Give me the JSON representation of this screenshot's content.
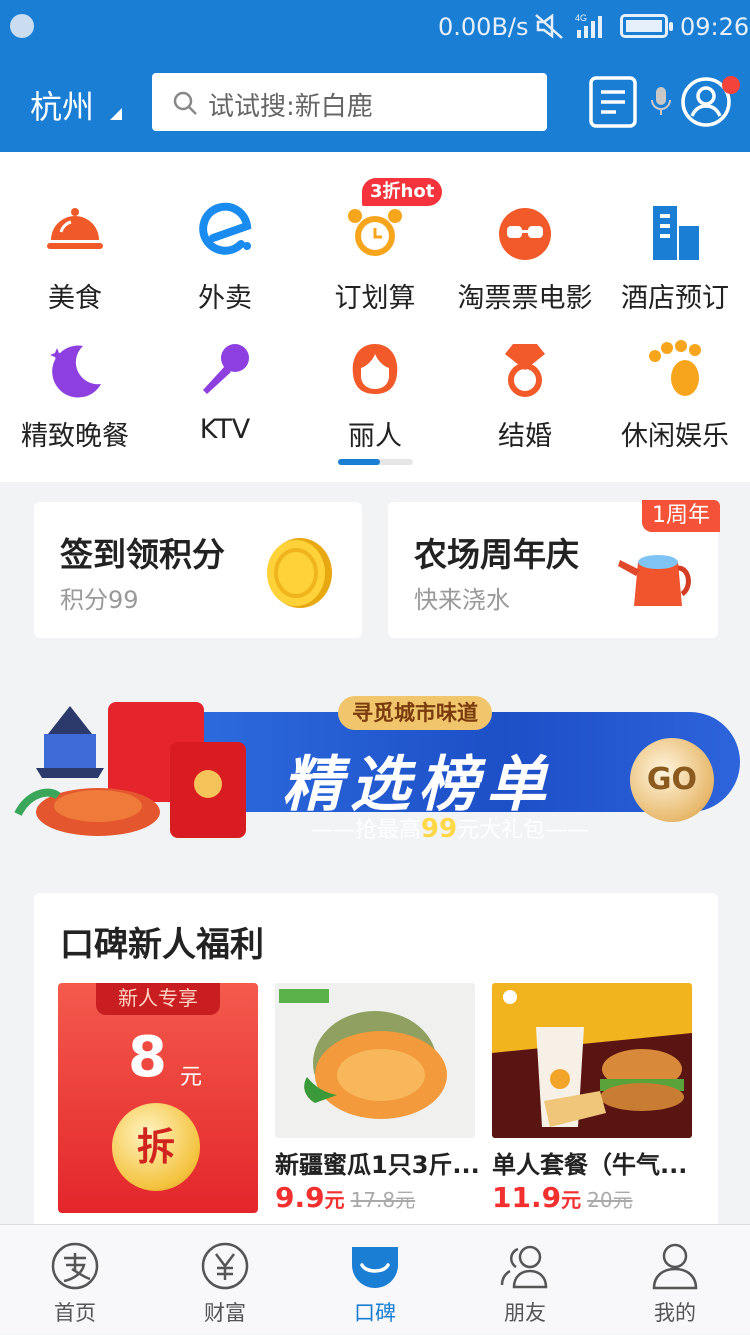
{
  "status_bar": {
    "speed": "0.00B/s",
    "network": "4G",
    "time": "09:26"
  },
  "header": {
    "city": "杭州",
    "search_placeholder": "试试搜:新白鹿"
  },
  "categories": [
    {
      "label": "美食",
      "icon": "food-cloche-icon"
    },
    {
      "label": "外卖",
      "icon": "ele-me-icon"
    },
    {
      "label": "订划算",
      "icon": "alarm-clock-icon",
      "badge": "3折hot"
    },
    {
      "label": "淘票票电影",
      "icon": "movie-glasses-icon"
    },
    {
      "label": "酒店预订",
      "icon": "hotel-building-icon"
    },
    {
      "label": "精致晚餐",
      "icon": "moon-star-icon"
    },
    {
      "label": "KTV",
      "icon": "microphone-icon"
    },
    {
      "label": "丽人",
      "icon": "beauty-face-icon"
    },
    {
      "label": "结婚",
      "icon": "wedding-ring-icon"
    },
    {
      "label": "休闲娱乐",
      "icon": "paw-icon"
    }
  ],
  "cards": {
    "checkin": {
      "title": "签到领积分",
      "subtitle": "积分99",
      "icon": "gold-coin-icon"
    },
    "farm": {
      "title": "农场周年庆",
      "subtitle": "快来浇水",
      "badge": "1周年",
      "icon": "watering-can-icon"
    }
  },
  "banner": {
    "tag": "寻觅城市味道",
    "title": "精选榜单",
    "sub_prefix": "——抢最高",
    "sub_amount": "99",
    "sub_suffix": "元大礼包——",
    "go": "GO"
  },
  "welfare": {
    "title": "口碑新人福利",
    "coupon": {
      "tag": "新人专享",
      "amount": "8",
      "unit": "元",
      "label": "拆"
    },
    "products": [
      {
        "name": "新疆蜜瓜1只3斤...",
        "price": "9.9",
        "unit": "元",
        "old_price": "17.8元"
      },
      {
        "name": "单人套餐（牛气...",
        "price": "11.9",
        "unit": "元",
        "old_price": "20元"
      }
    ]
  },
  "tabs": [
    {
      "label": "首页",
      "icon": "alipay-icon"
    },
    {
      "label": "财富",
      "icon": "yuan-icon"
    },
    {
      "label": "口碑",
      "icon": "koubei-icon",
      "active": true
    },
    {
      "label": "朋友",
      "icon": "friends-icon"
    },
    {
      "label": "我的",
      "icon": "profile-icon"
    }
  ],
  "colors": {
    "brand_blue": "#1a7fd4",
    "price_red": "#f23030",
    "badge_red": "#f4333c"
  }
}
